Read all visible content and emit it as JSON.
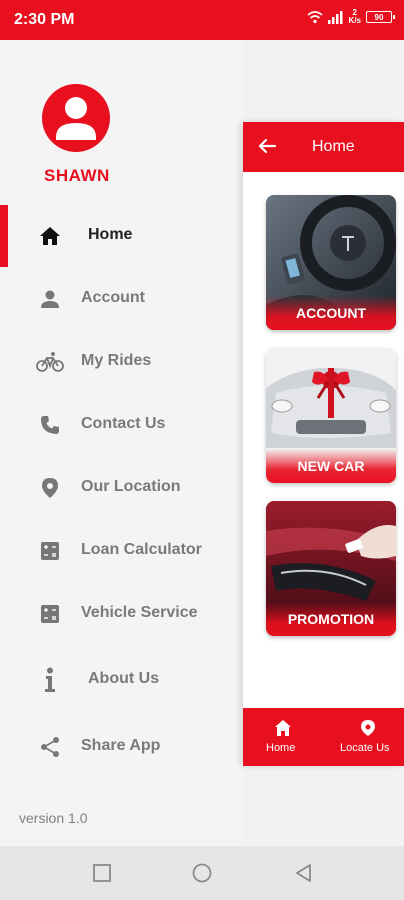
{
  "status_bar": {
    "time": "2:30 PM",
    "speed_value": "2",
    "speed_unit": "K/s",
    "battery": "90"
  },
  "drawer": {
    "profile_name": "SHAWN",
    "version": "version 1.0",
    "items": [
      {
        "label": "Home",
        "icon": "home-icon"
      },
      {
        "label": "Account",
        "icon": "person-icon"
      },
      {
        "label": "My Rides",
        "icon": "bike-icon"
      },
      {
        "label": "Contact Us",
        "icon": "phone-icon"
      },
      {
        "label": "Our Location",
        "icon": "location-pin-icon"
      },
      {
        "label": "Loan Calculator",
        "icon": "calculator-icon"
      },
      {
        "label": "Vehicle Service",
        "icon": "calculator-icon"
      },
      {
        "label": "About Us",
        "icon": "info-icon"
      },
      {
        "label": "Share App",
        "icon": "share-icon"
      }
    ]
  },
  "main": {
    "title": "Home",
    "cards": [
      {
        "label": "ACCOUNT"
      },
      {
        "label": "NEW CAR"
      },
      {
        "label": "PROMOTION"
      }
    ],
    "bottom_nav": [
      {
        "label": "Home",
        "icon": "home-icon"
      },
      {
        "label": "Locate Us",
        "icon": "location-pin-icon"
      }
    ]
  },
  "colors": {
    "brand": "#e8101f",
    "drawer_bg": "#f4f4f4",
    "menu_text": "#7a7a7a"
  }
}
